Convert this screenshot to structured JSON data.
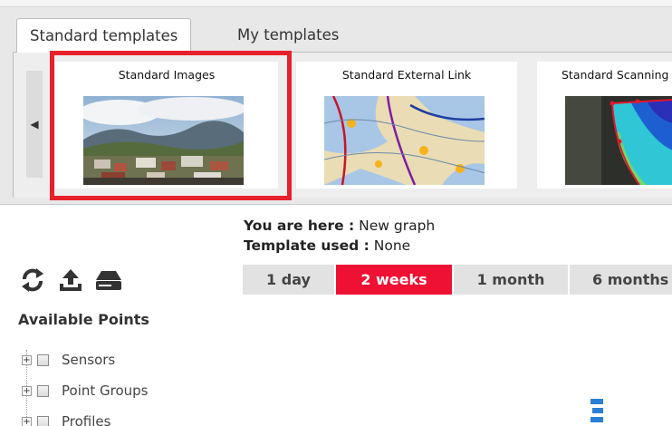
{
  "tabs": [
    {
      "label": "Standard templates",
      "active": true
    },
    {
      "label": "My templates",
      "active": false
    }
  ],
  "templates": [
    {
      "title": "Standard Images",
      "selected": true
    },
    {
      "title": "Standard External Link",
      "selected": false
    },
    {
      "title": "Standard Scanning",
      "selected": false
    }
  ],
  "location": {
    "you_are_here_label": "You are here :",
    "you_are_here_value": "New graph",
    "template_used_label": "Template used :",
    "template_used_value": "None"
  },
  "toolbar": {
    "icons": [
      "refresh-icon",
      "upload-icon",
      "drive-icon"
    ]
  },
  "time_ranges": [
    {
      "label": "1 day",
      "active": false
    },
    {
      "label": "2 weeks",
      "active": true
    },
    {
      "label": "1 month",
      "active": false
    },
    {
      "label": "6 months",
      "active": false
    }
  ],
  "points": {
    "title": "Available Points",
    "items": [
      {
        "label": "Sensors"
      },
      {
        "label": "Point Groups"
      },
      {
        "label": "Profiles"
      }
    ]
  },
  "colors": {
    "accent": "#ee1133",
    "selection": "#e8202b"
  }
}
